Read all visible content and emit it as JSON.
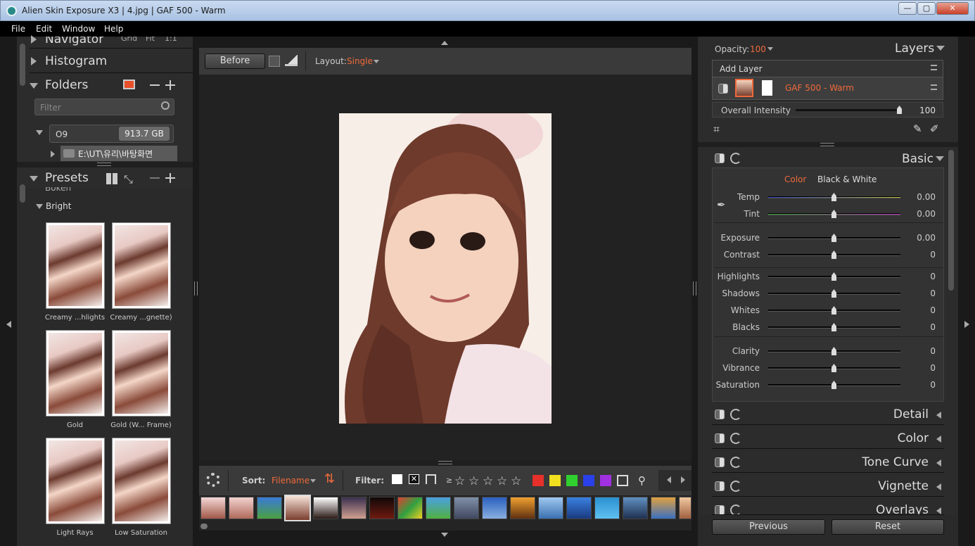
{
  "window": {
    "title": "Alien Skin Exposure X3 | 4.jpg | GAF 500 - Warm",
    "min": "—",
    "max": "▢",
    "close": "✕"
  },
  "menu": [
    "File",
    "Edit",
    "Window",
    "Help"
  ],
  "left": {
    "navigator": {
      "label": "Navigator",
      "grid": "Grid",
      "fit": "Fit",
      "one": "1:1"
    },
    "histogram": "Histogram",
    "folders": {
      "label": "Folders",
      "filter_placeholder": "Filter",
      "drive": "O9",
      "drive_size": "913.7 GB",
      "path": "E:\\UT\\유리\\바탕화면"
    },
    "presets": {
      "label": "Presets",
      "prev_group": "Bokeh",
      "group": "Bright",
      "items": [
        "Creamy ...hlights",
        "Creamy ...gnette)",
        "Gold",
        "Gold (W... Frame)",
        "Light Rays",
        "Low Saturation"
      ]
    }
  },
  "center": {
    "before": "Before",
    "layout_label": "Layout:",
    "layout_value": "Single",
    "sort_label": "Sort:",
    "sort_value": "Filename",
    "filter_label": "Filter:",
    "rating_prefix": "≥",
    "colors": [
      "#e8302a",
      "#f0e020",
      "#30d030",
      "#2a40e8",
      "#a030e0"
    ]
  },
  "right": {
    "opacity_label": "Opacity:",
    "opacity_value": "100",
    "layers_label": "Layers",
    "add_layer": "Add Layer",
    "layer_name": "GAF 500 - Warm",
    "overall_intensity_label": "Overall Intensity",
    "overall_intensity_value": "100",
    "basic_label": "Basic",
    "tab_color": "Color",
    "tab_bw": "Black & White",
    "sliders": [
      {
        "label": "Temp",
        "value": "0.00"
      },
      {
        "label": "Tint",
        "value": "0.00"
      },
      {
        "label": "Exposure",
        "value": "0.00"
      },
      {
        "label": "Contrast",
        "value": "0"
      },
      {
        "label": "Highlights",
        "value": "0"
      },
      {
        "label": "Shadows",
        "value": "0"
      },
      {
        "label": "Whites",
        "value": "0"
      },
      {
        "label": "Blacks",
        "value": "0"
      },
      {
        "label": "Clarity",
        "value": "0"
      },
      {
        "label": "Vibrance",
        "value": "0"
      },
      {
        "label": "Saturation",
        "value": "0"
      }
    ],
    "sections": [
      "Detail",
      "Color",
      "Tone Curve",
      "Vignette",
      "Overlays"
    ],
    "previous": "Previous",
    "reset": "Reset"
  },
  "colors": {
    "accent": "#f06a3a",
    "panel": "#2c2c2c",
    "background": "#1a1a1a"
  }
}
